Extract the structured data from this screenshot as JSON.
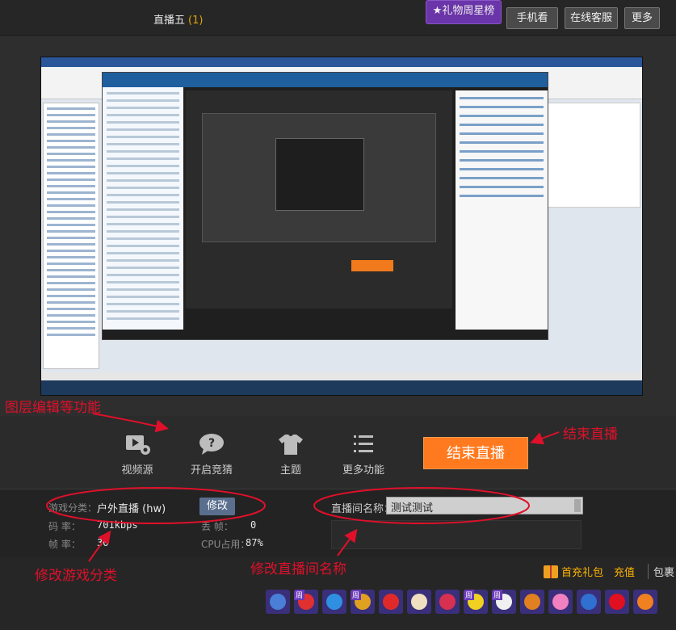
{
  "header": {
    "room_title": "直播五",
    "room_count": "(1)",
    "buttons": {
      "gift_rank": "★礼物周星榜",
      "phone_watch": "手机看",
      "online_service": "在线客服",
      "more": "更多"
    }
  },
  "controls": {
    "video_source": "视频源",
    "start_quiz": "开启竞猜",
    "theme": "主题",
    "more_functions": "更多功能",
    "end_live": "结束直播"
  },
  "info": {
    "game_category_label": "游戏分类：",
    "game_category_value": "户外直播 (hw)",
    "modify": "修改",
    "bitrate_label": "码    率：",
    "bitrate_value": "701kbps",
    "frame_rate_label": "帧    率：",
    "frame_rate_value": "30",
    "lost_frames_label": "丢    帧：",
    "lost_frames_value": "0",
    "cpu_label": "CPU占用：",
    "cpu_value": "87%",
    "room_name_label": "直播间名称：",
    "room_name_value": "测试测试"
  },
  "gifts": {
    "first_recharge_gift": "首充礼包",
    "recharge": "充值",
    "package": "包裹",
    "items": [
      {
        "icon": "rocket-icon",
        "color": "#4a7fd8",
        "weekly": false
      },
      {
        "icon": "heart-box-icon",
        "color": "#e03030",
        "weekly": true
      },
      {
        "icon": "blue-bird-icon",
        "color": "#2f8fe0",
        "weekly": false
      },
      {
        "icon": "gold-cart-icon",
        "color": "#e0a020",
        "weekly": true
      },
      {
        "icon": "apple-icon",
        "color": "#e02a2a",
        "weekly": false
      },
      {
        "icon": "ball-icon",
        "color": "#f0e0c0",
        "weekly": false
      },
      {
        "icon": "clock-icon",
        "color": "#d83050",
        "weekly": false
      },
      {
        "icon": "chick-icon",
        "color": "#f0d020",
        "weekly": true
      },
      {
        "icon": "penguin-icon",
        "color": "#f0f0f0",
        "weekly": true
      },
      {
        "icon": "awesome-icon",
        "color": "#e08020",
        "weekly": false
      },
      {
        "icon": "cute-icon",
        "color": "#f080c0",
        "weekly": false
      },
      {
        "icon": "wave-icon",
        "color": "#3070d0",
        "weekly": false
      },
      {
        "icon": "red-envelope-icon",
        "color": "#e01020",
        "weekly": false
      },
      {
        "icon": "basketball-icon",
        "color": "#f08020",
        "weekly": false
      }
    ],
    "weekly_badge": "周"
  },
  "annotations": {
    "layer_edit": "图层编辑等功能",
    "end_live": "结束直播",
    "modify_game": "修改游戏分类",
    "modify_room": "修改直播间名称"
  },
  "colors": {
    "accent_orange": "#ff7a1f",
    "annotation_red": "#e0102a",
    "gift_button_purple": "#6a35a8"
  }
}
